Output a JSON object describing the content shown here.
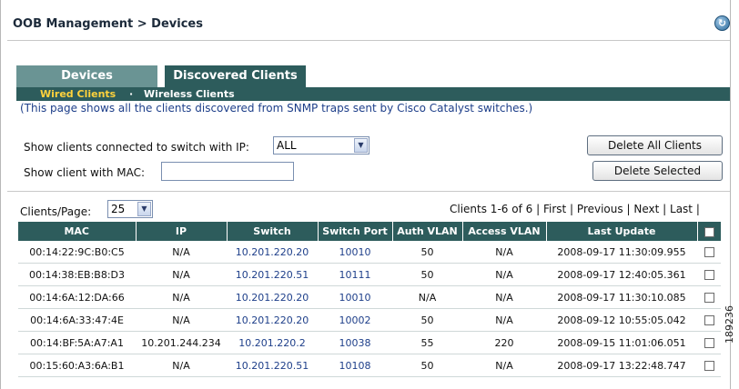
{
  "header": {
    "title": "OOB Management > Devices",
    "help_glyph": "↻"
  },
  "tabs": [
    {
      "label": "Devices",
      "active": false
    },
    {
      "label": "Discovered Clients",
      "active": true
    }
  ],
  "subtabs": {
    "wired": "Wired Clients",
    "separator": "·",
    "wireless": "Wireless Clients"
  },
  "info": "(This page shows all the clients discovered from SNMP traps sent by Cisco Catalyst switches.)",
  "filters": {
    "switch_ip_label": "Show clients connected to switch with IP:",
    "switch_ip_value": "ALL",
    "mac_label": "Show client with MAC:",
    "mac_value": ""
  },
  "buttons": {
    "delete_all": "Delete All Clients",
    "delete_selected": "Delete Selected"
  },
  "paging": {
    "clients_per_page_label": "Clients/Page:",
    "clients_per_page_value": "25",
    "summary": "Clients 1-6 of 6",
    "first": "First",
    "previous": "Previous",
    "next": "Next",
    "last": "Last",
    "sep": "|"
  },
  "table": {
    "columns": [
      "MAC",
      "IP",
      "Switch",
      "Switch Port",
      "Auth VLAN",
      "Access VLAN",
      "Last Update"
    ],
    "rows": [
      {
        "mac": "00:14:22:9C:B0:C5",
        "ip": "N/A",
        "switch": "10.201.220.20",
        "port": "10010",
        "auth_vlan": "50",
        "access_vlan": "N/A",
        "last_update": "2008-09-17 11:30:09.955"
      },
      {
        "mac": "00:14:38:EB:B8:D3",
        "ip": "N/A",
        "switch": "10.201.220.51",
        "port": "10111",
        "auth_vlan": "50",
        "access_vlan": "N/A",
        "last_update": "2008-09-17 12:40:05.361"
      },
      {
        "mac": "00:14:6A:12:DA:66",
        "ip": "N/A",
        "switch": "10.201.220.20",
        "port": "10010",
        "auth_vlan": "N/A",
        "access_vlan": "N/A",
        "last_update": "2008-09-17 11:30:10.085"
      },
      {
        "mac": "00:14:6A:33:47:4E",
        "ip": "N/A",
        "switch": "10.201.220.20",
        "port": "10002",
        "auth_vlan": "50",
        "access_vlan": "N/A",
        "last_update": "2008-09-12 10:55:05.042"
      },
      {
        "mac": "00:14:BF:5A:A7:A1",
        "ip": "10.201.244.234",
        "switch": "10.201.220.2",
        "port": "10038",
        "auth_vlan": "55",
        "access_vlan": "220",
        "last_update": "2008-09-15 11:01:06.051"
      },
      {
        "mac": "00:15:60:A3:6A:B1",
        "ip": "N/A",
        "switch": "10.201.220.51",
        "port": "10108",
        "auth_vlan": "50",
        "access_vlan": "N/A",
        "last_update": "2008-09-17 13:22:48.747"
      }
    ]
  },
  "side_code": "189236",
  "colors": {
    "tab_dark": "#2d5c5c",
    "tab_light": "#6a9494",
    "active_subtab": "#ffd23c",
    "link": "#1e3f8a"
  },
  "icons": {
    "help": "refresh-help-icon",
    "dropdown": "chevron-down-icon",
    "checkbox": "checkbox-icon"
  }
}
